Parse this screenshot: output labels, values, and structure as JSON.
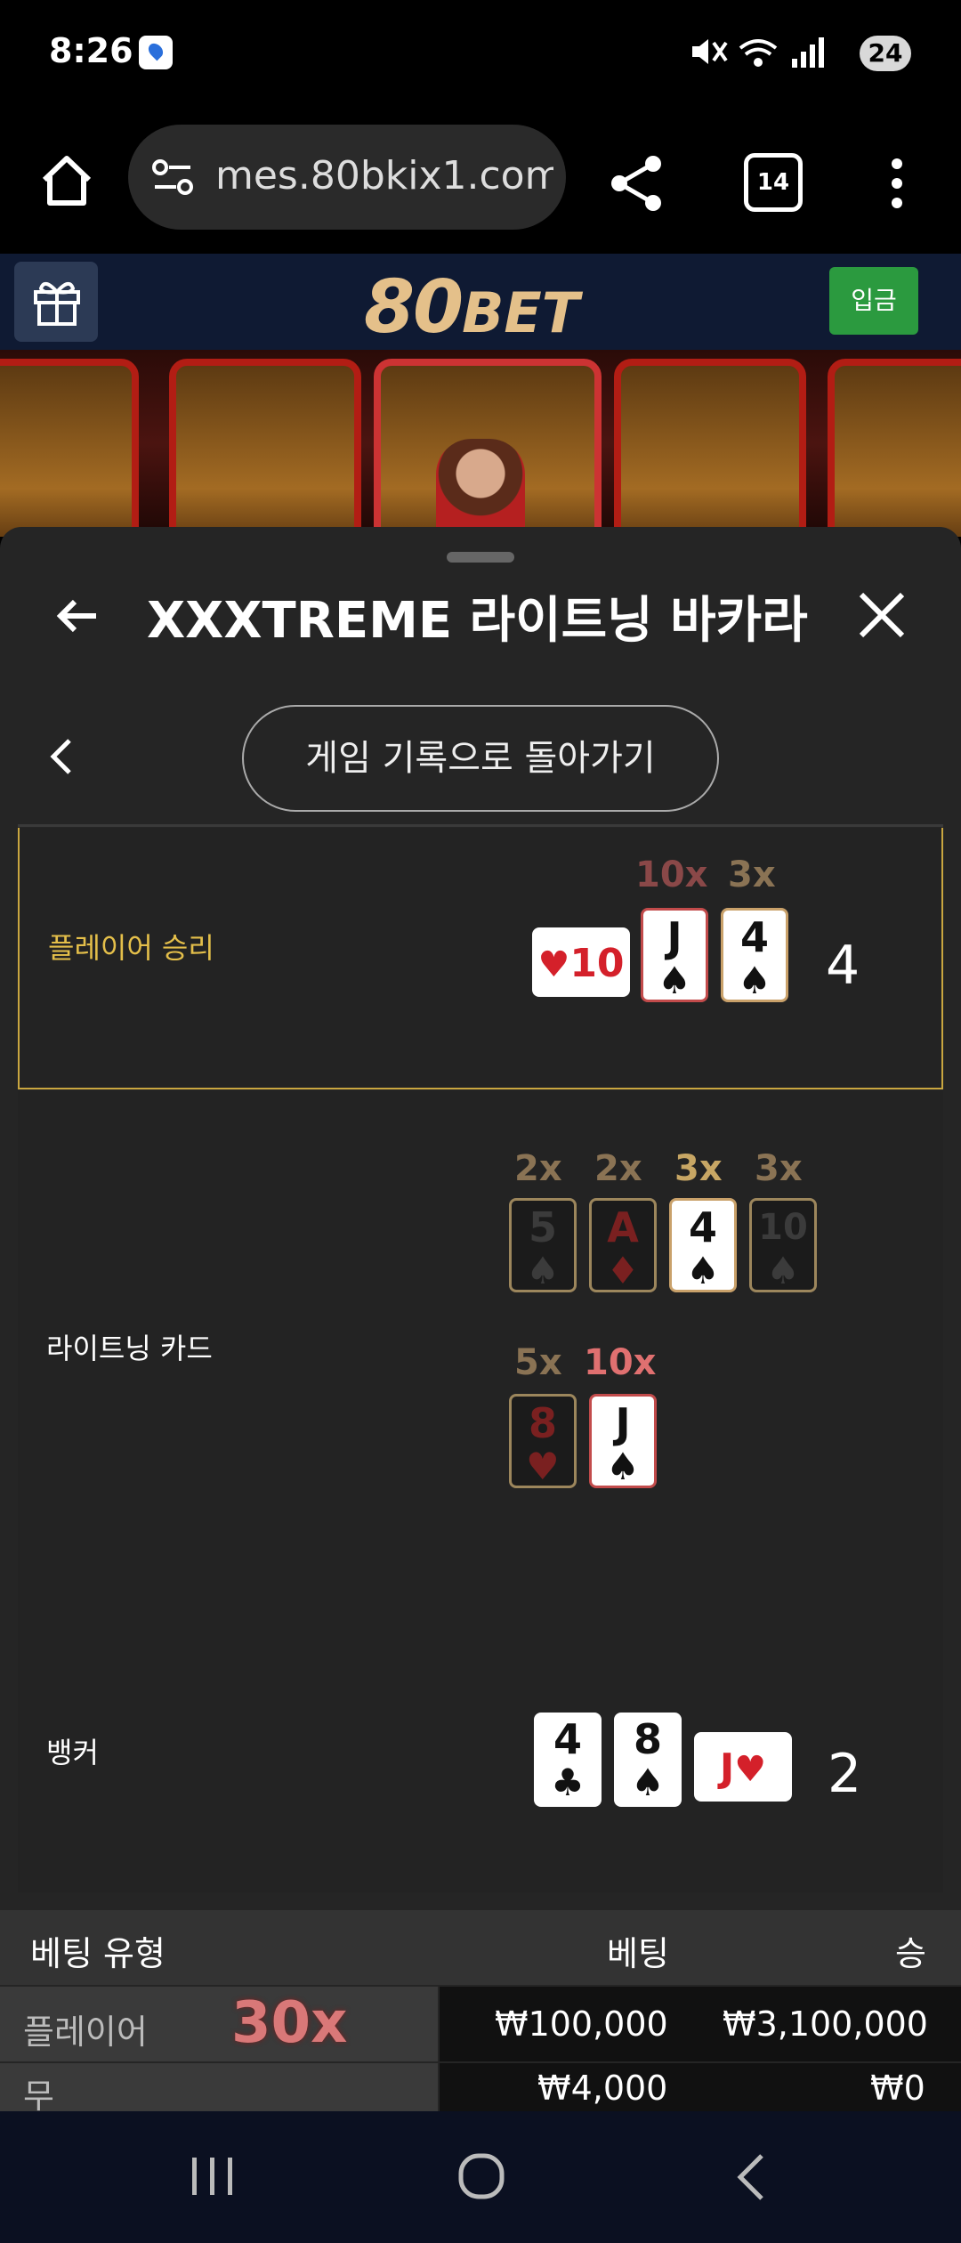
{
  "status_bar": {
    "time": "8:26",
    "icons": [
      "pin-icon",
      "mute-icon",
      "wifi-icon",
      "signal-icon"
    ],
    "battery": "24"
  },
  "browser": {
    "url": "mes.80bkix1.com",
    "tab_count": "14",
    "icons": [
      "home-icon",
      "site-settings-icon",
      "share-icon",
      "tabs-icon",
      "more-icon"
    ]
  },
  "site": {
    "logo_big": "80",
    "logo_small": "BET",
    "deposit_label": "입금",
    "colors": {
      "header": "#0f1a33",
      "deposit": "#2b9a3f",
      "logo": "#e4c08a"
    }
  },
  "panel": {
    "title": "XXXTREME 라이트닝 바카라",
    "back_to_history": "게임 기록으로 돌아가기"
  },
  "player": {
    "label": "플레이어 승리",
    "score": "4",
    "side_card": {
      "rank": "10",
      "suit": "♥"
    },
    "cards": [
      {
        "rank": "J",
        "suit": "♠",
        "mult": "10x"
      },
      {
        "rank": "4",
        "suit": "♠",
        "mult": "3x"
      }
    ]
  },
  "lightning": {
    "label": "라이트닝 카드",
    "cards": [
      {
        "rank": "5",
        "suit": "♠",
        "mult": "2x"
      },
      {
        "rank": "A",
        "suit": "♦",
        "mult": "2x"
      },
      {
        "rank": "4",
        "suit": "♠",
        "mult": "3x"
      },
      {
        "rank": "10",
        "suit": "♠",
        "mult": "3x"
      },
      {
        "rank": "8",
        "suit": "♥",
        "mult": "5x"
      },
      {
        "rank": "J",
        "suit": "♠",
        "mult": "10x"
      }
    ]
  },
  "banker": {
    "label": "뱅커",
    "score": "2",
    "cards": [
      {
        "rank": "4",
        "suit": "♣"
      },
      {
        "rank": "8",
        "suit": "♠"
      }
    ],
    "side_card": {
      "rank": "J",
      "suit": "♥"
    }
  },
  "bets": {
    "headers": {
      "type": "베팅 유형",
      "bet": "베팅",
      "win": "승"
    },
    "rows": [
      {
        "type": "플레이어",
        "multiplier": "30x",
        "bet": "₩100,000",
        "win": "₩3,100,000"
      },
      {
        "type": "무",
        "multiplier": "",
        "bet": "₩4,000",
        "win": "₩0"
      }
    ]
  }
}
